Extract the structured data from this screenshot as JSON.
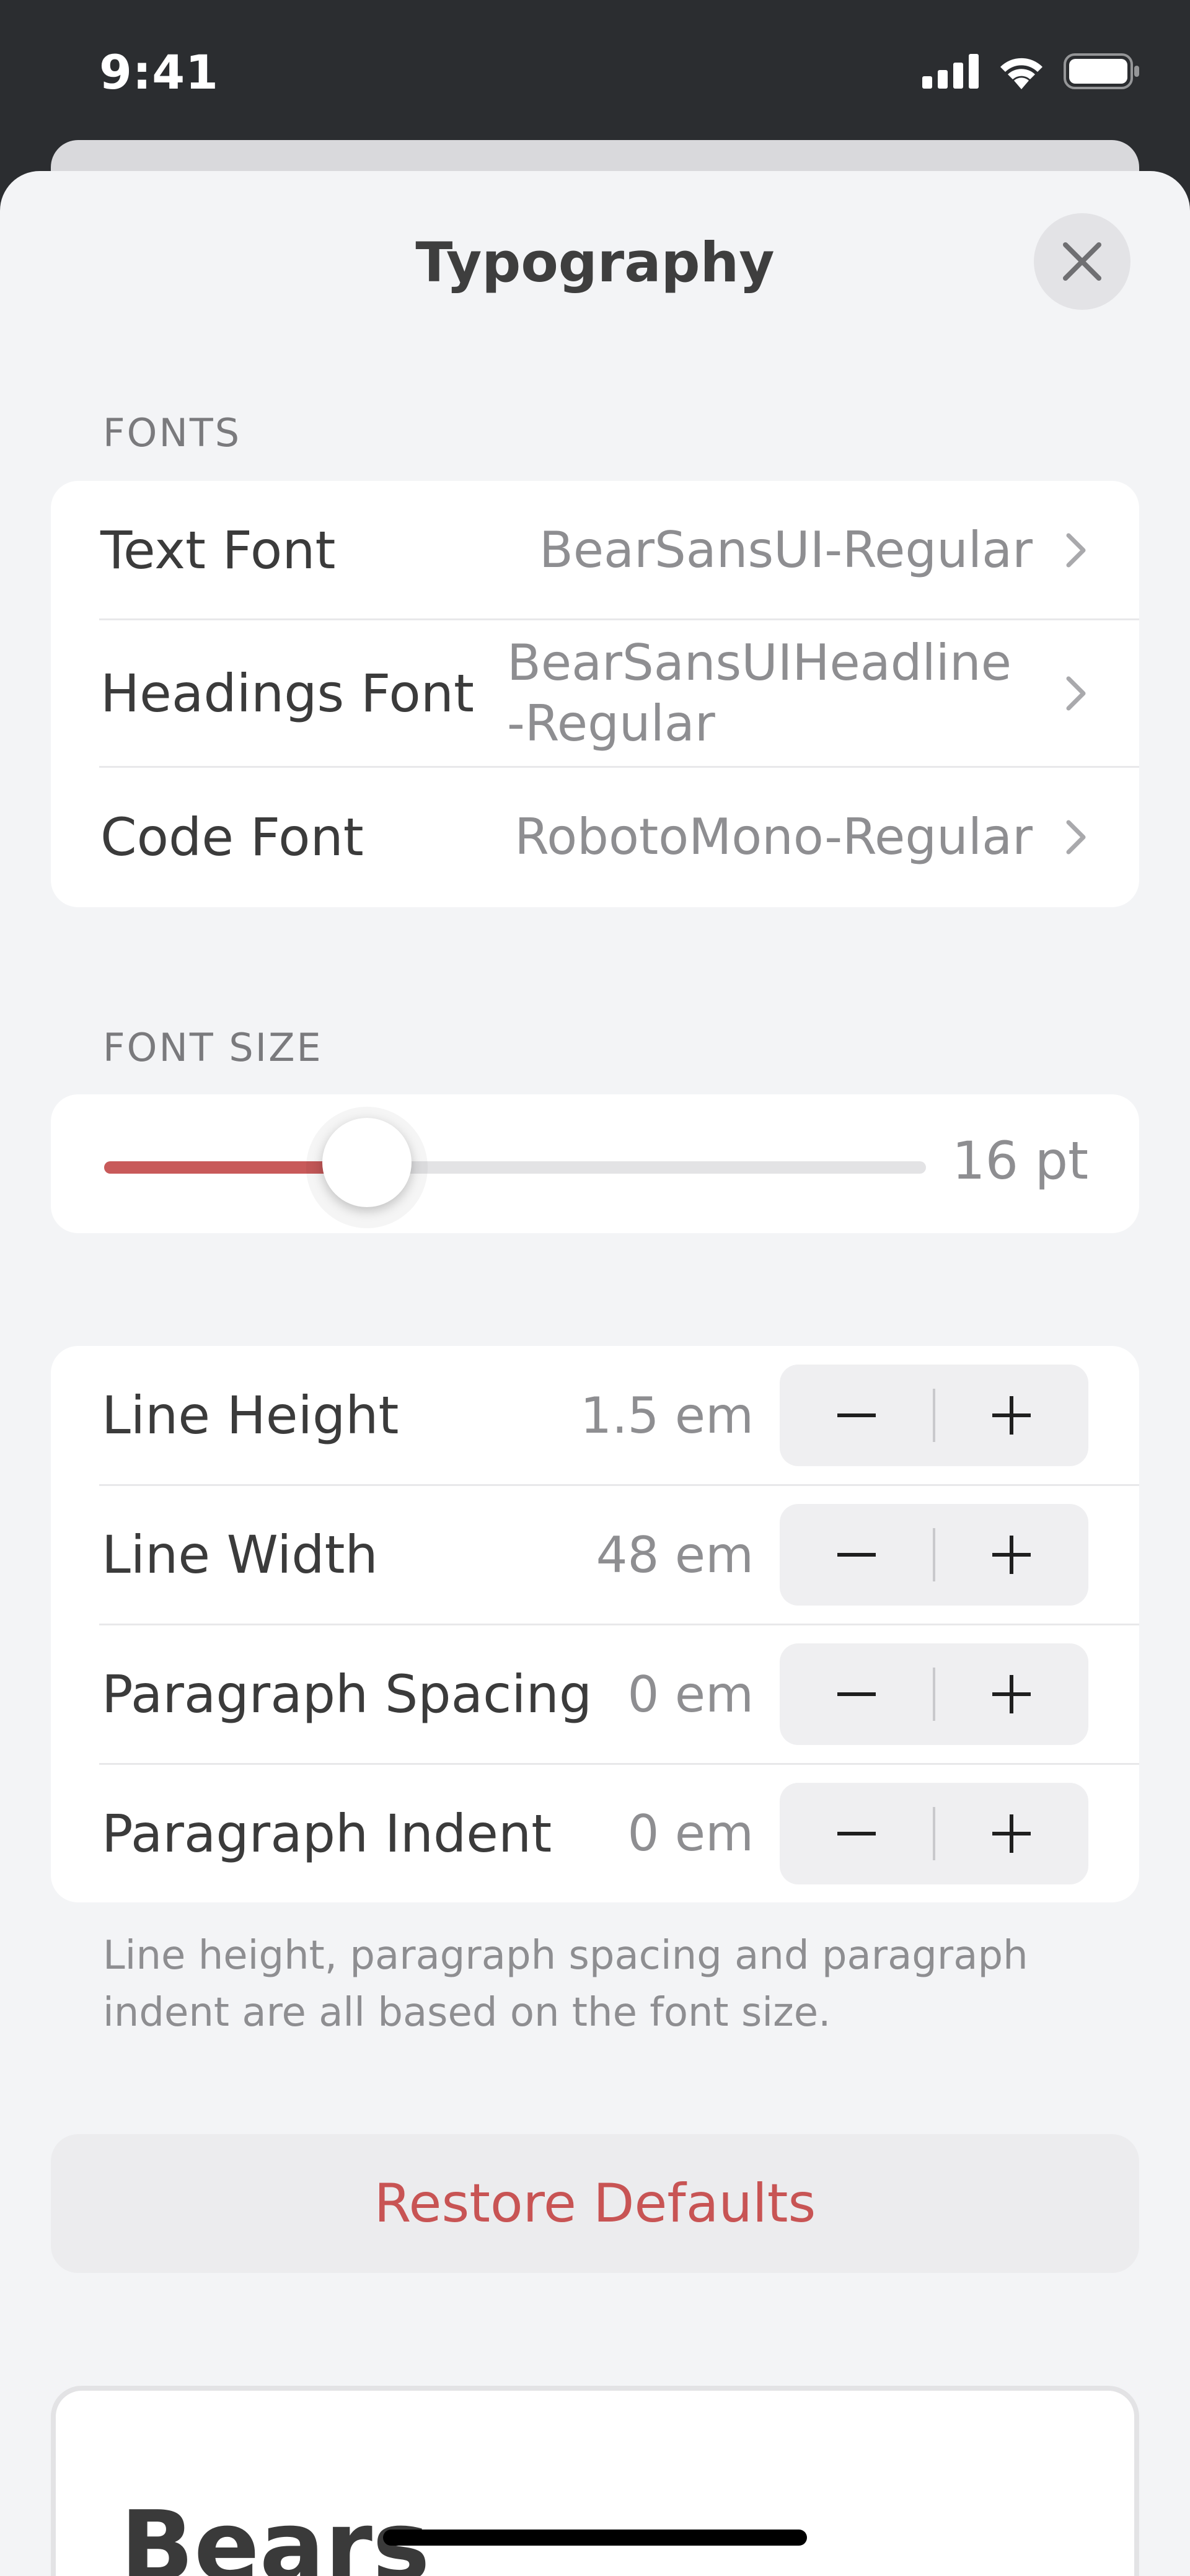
{
  "status": {
    "time": "9:41"
  },
  "sheet": {
    "title": "Typography"
  },
  "fonts": {
    "header": "FONTS",
    "rows": [
      {
        "label": "Text Font",
        "value": "BearSansUI-Regular"
      },
      {
        "label": "Headings Font",
        "value_line1": "BearSansUIHeadline",
        "value_line2": "-Regular"
      },
      {
        "label": "Code Font",
        "value": "RobotoMono-Regular"
      }
    ]
  },
  "font_size": {
    "header": "FONT SIZE",
    "value_label": "16 pt",
    "slider_fraction": 0.32,
    "accent_color": "#c85a5a"
  },
  "spacing": {
    "rows": [
      {
        "label": "Line Height",
        "value": "1.5 em"
      },
      {
        "label": "Line Width",
        "value": "48 em"
      },
      {
        "label": "Paragraph Spacing",
        "value": "0 em"
      },
      {
        "label": "Paragraph Indent",
        "value": "0 em"
      }
    ],
    "minus": "−",
    "plus": "+"
  },
  "footnote": "Line height, paragraph spacing and paragraph indent are all based on the font size.",
  "restore": {
    "label": "Restore Defaults",
    "color": "#c85454"
  },
  "preview": {
    "heading": "Bears"
  }
}
